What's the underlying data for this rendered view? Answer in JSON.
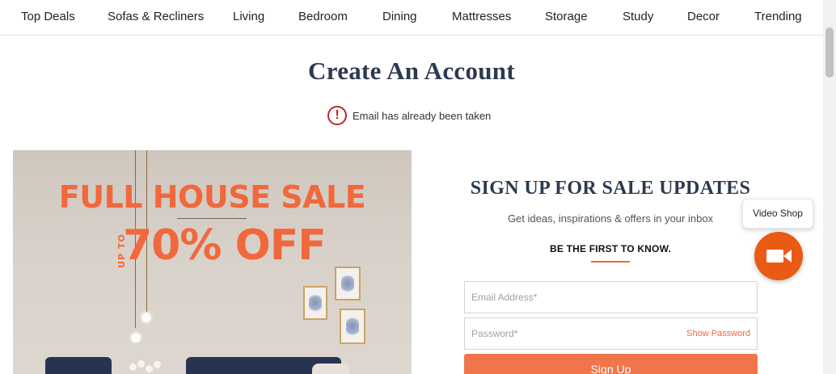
{
  "nav": {
    "items": [
      "Top Deals",
      "Sofas & Recliners",
      "Living",
      "Bedroom",
      "Dining",
      "Mattresses",
      "Storage",
      "Study",
      "Decor",
      "Trending"
    ]
  },
  "page": {
    "title": "Create An Account",
    "error_icon": "alert-circle-icon",
    "error_message": "Email has already been taken"
  },
  "banner": {
    "headline": "FULL HOUSE SALE",
    "upto": "UP TO",
    "discount": "70% OFF"
  },
  "signup": {
    "title": "SIGN UP FOR SALE UPDATES",
    "subtitle": "Get ideas, inspirations & offers in your inbox",
    "kicker": "BE THE FIRST TO KNOW.",
    "email_placeholder": "Email Address*",
    "password_placeholder": "Password*",
    "show_password": "Show Password",
    "button_label": "Sign Up"
  },
  "video_shop": {
    "label": "Video Shop",
    "icon": "video-camera-icon"
  },
  "colors": {
    "accent": "#f1683c",
    "button": "#f0754a",
    "video_button": "#ea5a14",
    "title": "#2c3a4f",
    "error": "#c0242f"
  }
}
